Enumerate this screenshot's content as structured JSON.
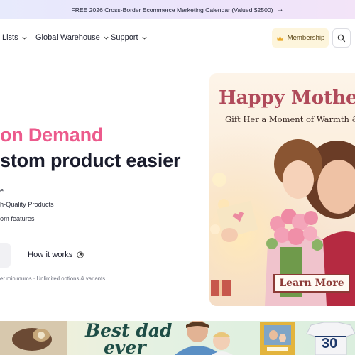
{
  "announcement": {
    "text": "FREE 2026 Cross-Border Ecommerce Marketing Calendar (Valued $2500)",
    "arrow": "→"
  },
  "nav": {
    "items": [
      {
        "label": "Lists"
      },
      {
        "label": "Global Warehouse"
      },
      {
        "label": "Support"
      }
    ],
    "membership": {
      "label": "Membership",
      "icon": "crown-icon"
    },
    "search_icon": "search-icon"
  },
  "hero": {
    "line1": "on Demand",
    "line2": "stom product easier",
    "features": [
      "e",
      "h-Quality Products",
      "om features"
    ],
    "how_it_works": "How it works",
    "footnote": "er minimums · Unlimited options & variants"
  },
  "promo": {
    "title": "Happy Mother's",
    "subtitle": "Gift Her a Moment of Warmth & A",
    "cta": "Learn More"
  },
  "banner": {
    "line1": "Best dad",
    "line2": "ever",
    "jersey_number": "30"
  },
  "colors": {
    "accent_pink": "#ec5a8c",
    "membership_bg": "#fdf5dc",
    "promo_title": "#b04a5a",
    "banner_text": "#1e4d46"
  }
}
